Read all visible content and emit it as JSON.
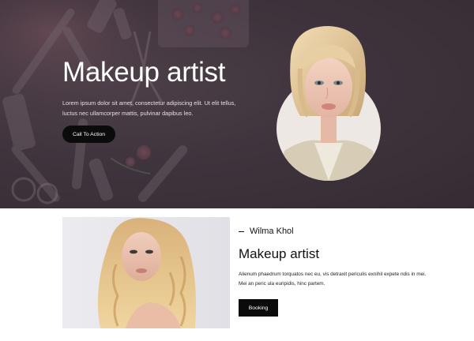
{
  "hero": {
    "title": "Makeup artist",
    "description": "Lorem ipsum dolor sit amet, consectetur adipiscing elit. Ut elit tellus, luctus nec ullamcorper mattis, pulvinar dapibus leo.",
    "cta_label": "Call To Action"
  },
  "profile": {
    "byline_name": "Wilma Khol",
    "title": "Makeup artist",
    "description": "Alienum phaedrum torquatos nec eu, vis detraxit periculis exnihil expete ndis in mei. Mei an peric ula euripidis, hinc partem.",
    "booking_label": "Booking"
  },
  "colors": {
    "hero_background": "#3f343d",
    "button": "#0b0b0b",
    "text_light": "#ffffff",
    "text_dark": "#111111"
  }
}
